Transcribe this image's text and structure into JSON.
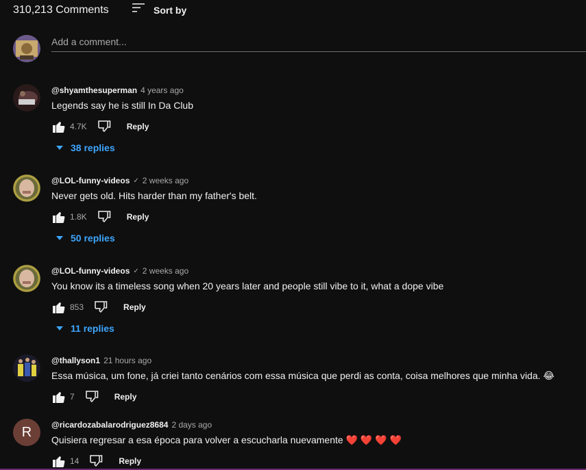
{
  "header": {
    "comment_count": "310,213 Comments",
    "sort_label": "Sort by",
    "sort_icon": "sort-lines-icon"
  },
  "add_comment": {
    "placeholder": "Add a comment..."
  },
  "comments": [
    {
      "author": "@shyamthesuperman",
      "verified": false,
      "time": "4 years ago",
      "text": "Legends say he is still In Da Club",
      "likes": "4.7K",
      "reply_label": "Reply",
      "replies_label": "38 replies"
    },
    {
      "author": "@LOL-funny-videos",
      "verified": true,
      "time": "2 weeks ago",
      "text": "Never gets old. Hits harder than my father's belt.",
      "likes": "1.8K",
      "reply_label": "Reply",
      "replies_label": "50 replies"
    },
    {
      "author": "@LOL-funny-videos",
      "verified": true,
      "time": "2 weeks ago",
      "text": "You know its a timeless song when 20 years later and people still vibe to it, what a dope vibe",
      "likes": "853",
      "reply_label": "Reply",
      "replies_label": "11 replies"
    },
    {
      "author": "@thallyson1",
      "verified": false,
      "time": "21 hours ago",
      "text": "Essa música, um fone, já criei tanto cenários com essa música que perdi as conta, coisa melhores que minha vida. 😂",
      "likes": "7",
      "reply_label": "Reply"
    },
    {
      "author": "@ricardozabalarodriguez8684",
      "verified": false,
      "time": "2 days ago",
      "text": "Quisiera regresar a esa época para volver a escucharla nuevamente ❤️ ❤️ ❤️ ❤️",
      "likes": "14",
      "reply_label": "Reply",
      "avatar_letter": "R"
    }
  ],
  "colors": {
    "background": "#0f0f0f",
    "link_blue": "#3ea6ff",
    "muted": "#aaaaaa"
  }
}
